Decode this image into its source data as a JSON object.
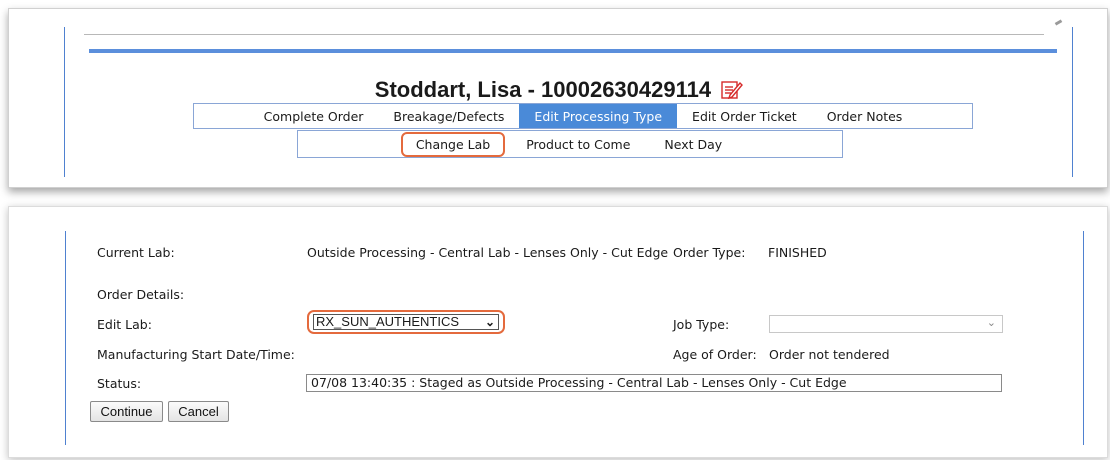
{
  "header": {
    "patient_name": "Stoddart, Lisa",
    "separator": " - ",
    "order_number": "10002630429114",
    "edit_icon": "edit-document-icon"
  },
  "menu": {
    "items": [
      {
        "label": "Complete Order",
        "active": false
      },
      {
        "label": "Breakage/Defects",
        "active": false
      },
      {
        "label": "Edit Processing Type",
        "active": true
      },
      {
        "label": "Edit Order Ticket",
        "active": false
      },
      {
        "label": "Order Notes",
        "active": false
      }
    ]
  },
  "submenu": {
    "items": [
      {
        "label": "Change Lab",
        "highlighted": true
      },
      {
        "label": "Product to Come",
        "highlighted": false
      },
      {
        "label": "Next Day",
        "highlighted": false
      }
    ]
  },
  "form": {
    "current_lab_label": "Current Lab:",
    "current_lab_value": "Outside Processing - Central Lab - Lenses Only - Cut Edge",
    "order_type_label": "Order Type:",
    "order_type_value": "FINISHED",
    "order_details_label": "Order Details:",
    "edit_lab_label": "Edit Lab:",
    "edit_lab_selected": "RX_SUN_AUTHENTICS",
    "job_type_label": "Job Type:",
    "job_type_selected": "",
    "mfg_start_label": "Manufacturing Start Date/Time:",
    "mfg_start_value": "",
    "age_label": "Age of Order:",
    "age_value": "Order not tendered",
    "status_label": "Status:",
    "status_value": "07/08 13:40:35 : Staged as Outside Processing - Central Lab - Lenses Only - Cut Edge"
  },
  "buttons": {
    "continue_label": "Continue",
    "cancel_label": "Cancel"
  },
  "colors": {
    "accent_blue": "#4a8ad8",
    "highlight_orange": "#e46a3d",
    "edit_icon_red": "#d62a2a"
  }
}
